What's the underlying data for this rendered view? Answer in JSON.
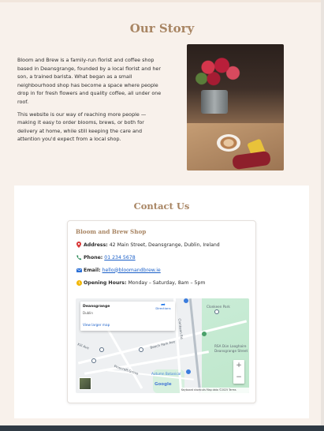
{
  "story": {
    "title": "Our Story",
    "paragraphs": [
      "Bloom and Brew is a family-run florist and coffee shop based in Deansgrange, founded by a local florist and her son, a trained barista. What began as a small neighbourhood shop has become a space where people drop in for fresh flowers and quality coffee, all under one roof.",
      "This website is our way of reaching more people — making it easy to order blooms, brews, or both for delivery at home, while still keeping the care and attention you'd expect from a local shop."
    ]
  },
  "contact": {
    "title": "Contact Us",
    "card_title": "Bloom and Brew Shop",
    "address_label": "Address:",
    "address_value": "42 Main Street, Deansgrange, Dublin, Ireland",
    "phone_label": "Phone:",
    "phone_value": "01 234 5678",
    "email_label": "Email:",
    "email_value": "hello@bloomandbrew.ie",
    "hours_label": "Opening Hours:",
    "hours_value": "Monday – Saturday, 8am – 5pm"
  },
  "map": {
    "place_name": "Deansgrange",
    "place_area": "Dublin",
    "view_larger": "View larger map",
    "directions": "Directions",
    "labels": [
      "Clonkeen Park",
      "Clonkeen Rd",
      "Beech Park Ave",
      "Kill Ave",
      "Pinecroft Grove",
      "RSA Dún Laoghaire",
      "Deansgrange Street",
      "Autumn Botanical"
    ],
    "zoom_in": "+",
    "zoom_out": "−",
    "google": "Google",
    "attribution": "Keyboard shortcuts   Map data ©2025   Terms"
  },
  "colors": {
    "page_bg": "#f8f1eb",
    "accent_title": "#a88563",
    "link": "#1a5fc8",
    "address_icon": "#d93a3a",
    "phone_icon": "#2a8a57",
    "email_icon": "#2b6fd6",
    "hours_icon": "#f2b705"
  },
  "icons": {
    "address": "map-pin-icon",
    "phone": "phone-icon",
    "email": "envelope-icon",
    "hours": "clock-icon"
  }
}
